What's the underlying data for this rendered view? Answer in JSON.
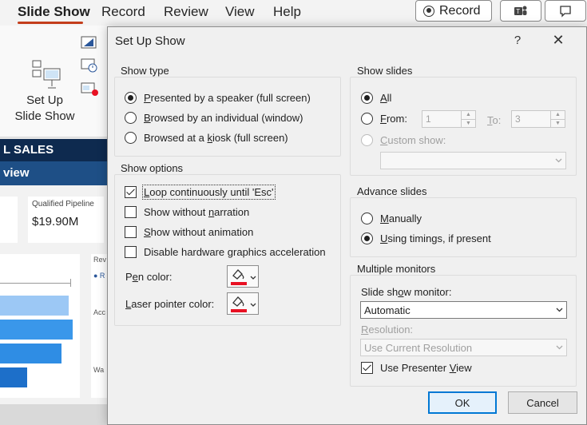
{
  "ribbon": {
    "tabs": [
      "Slide Show",
      "Record",
      "Review",
      "View",
      "Help"
    ],
    "record_button": "Record",
    "setup_button": [
      "Set Up",
      "Slide Show"
    ]
  },
  "slide": {
    "header": "L SALES",
    "subheader": "view",
    "kpi_label": "Qualified Pipeline",
    "kpi_value": "$19.90M",
    "side_labels": [
      "Rev",
      "● R",
      "Acc",
      "Wa"
    ]
  },
  "colors": {
    "accent": "#0078d4",
    "pen": "#e81123",
    "tab_underline": "#c43e1c",
    "slide_dark": "#0e2a4f",
    "slide_mid": "#1e4f86"
  },
  "dialog": {
    "title": "Set Up Show",
    "help": "?",
    "close": "✕",
    "show_type": {
      "label": "Show type",
      "options": [
        {
          "pre": "",
          "u": "P",
          "post": "resented by a speaker (full screen)",
          "selected": true
        },
        {
          "pre": "",
          "u": "B",
          "post": "rowsed by an individual (window)",
          "selected": false
        },
        {
          "pre": "Browsed at a ",
          "u": "k",
          "post": "iosk (full screen)",
          "selected": false
        }
      ]
    },
    "show_options": {
      "label": "Show options",
      "items": [
        {
          "pre": "",
          "u": "L",
          "post": "oop continuously until 'Esc'",
          "checked": true
        },
        {
          "pre": "Show without ",
          "u": "n",
          "post": "arration",
          "checked": false
        },
        {
          "pre": "",
          "u": "S",
          "post": "how without animation",
          "checked": false
        },
        {
          "pre": "Disable hardware ",
          "u": "g",
          "post": "raphics acceleration",
          "checked": false
        }
      ],
      "pen_color": {
        "pre": "P",
        "u": "e",
        "post": "n color:"
      },
      "laser_color": {
        "pre": "",
        "u": "L",
        "post": "aser pointer color:"
      }
    },
    "show_slides": {
      "label": "Show slides",
      "all": {
        "pre": "",
        "u": "A",
        "post": "ll",
        "selected": true
      },
      "from": {
        "pre": "",
        "u": "F",
        "post": "rom:",
        "selected": false,
        "value": "1"
      },
      "to": {
        "pre": "",
        "u": "T",
        "post": "o:",
        "value": "3"
      },
      "custom": {
        "pre": "",
        "u": "C",
        "post": "ustom show:",
        "selected": false
      }
    },
    "advance": {
      "label": "Advance slides",
      "manually": {
        "pre": "",
        "u": "M",
        "post": "anually",
        "selected": false
      },
      "timings": {
        "pre": "",
        "u": "U",
        "post": "sing timings, if present",
        "selected": true
      }
    },
    "monitors": {
      "label": "Multiple monitors",
      "monitor_label": {
        "pre": "Slide sh",
        "u": "o",
        "post": "w monitor:"
      },
      "monitor_value": "Automatic",
      "resolution_label": {
        "pre": "",
        "u": "R",
        "post": "esolution:"
      },
      "resolution_value": "Use Current Resolution",
      "presenter_view": {
        "pre": "Use Presenter ",
        "u": "V",
        "post": "iew",
        "checked": true
      }
    },
    "ok": "OK",
    "cancel": "Cancel"
  }
}
